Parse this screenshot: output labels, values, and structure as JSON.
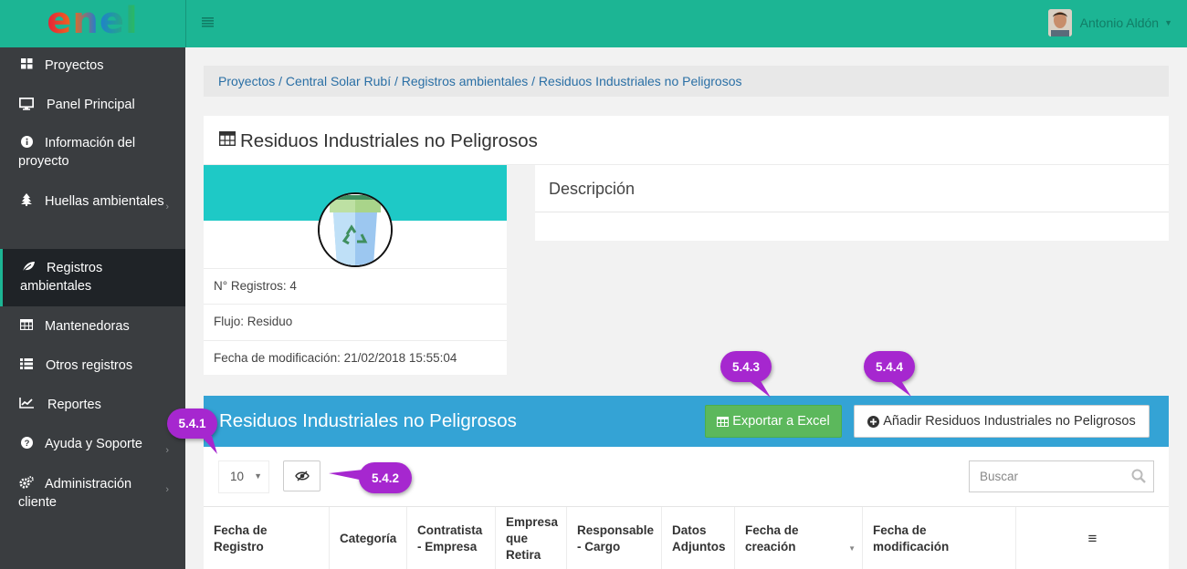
{
  "brand": {
    "logo_text": "enel",
    "logo_colors": [
      "#e41f3a",
      "#ee6a1e",
      "#1e7dd4",
      "#2bbf58"
    ]
  },
  "colors": {
    "accent": "#1cb594",
    "sidebar_bg": "#3a3d40",
    "sidebar_active_bg": "#1f2327",
    "bluebar": "#34a3d5",
    "excel_btn": "#5cb85c",
    "callout": "#a627cf"
  },
  "sidebar": {
    "items": [
      {
        "label": "Proyectos",
        "icon": "th-large-icon"
      },
      {
        "label": "Panel Principal",
        "icon": "monitor-icon"
      },
      {
        "label": "Información del proyecto",
        "icon": "info-circle-icon"
      },
      {
        "label": "Huellas ambientales",
        "icon": "tree-icon"
      },
      {
        "label": "Registros ambientales",
        "icon": "leaf-icon"
      },
      {
        "label": "Mantenedoras",
        "icon": "table-icon"
      },
      {
        "label": "Otros registros",
        "icon": "list-icon"
      },
      {
        "label": "Reportes",
        "icon": "line-chart-icon"
      },
      {
        "label": "Ayuda y Soporte",
        "icon": "question-circle-icon"
      },
      {
        "label": "Administración cliente",
        "icon": "cogs-icon"
      }
    ]
  },
  "topbar": {
    "user_name": "Antonio Aldón"
  },
  "breadcrumb": "Proyectos / Central Solar Rubí / Registros ambientales / Residuos Industriales no Peligrosos",
  "page_title": "Residuos Industriales no Peligrosos",
  "card": {
    "registros": "N° Registros: 4",
    "flujo": "Flujo: Residuo",
    "fecha_mod": "Fecha de modificación: 21/02/2018 15:55:04"
  },
  "description": {
    "title": "Descripción"
  },
  "table_panel": {
    "title": "Residuos Industriales no Peligrosos",
    "export_label": "Exportar a Excel",
    "add_label": "Añadir Residuos Industriales no Peligrosos",
    "page_length": "10",
    "search_placeholder": "Buscar",
    "columns": [
      "Fecha de Registro",
      "Categoría",
      "Contratista - Empresa",
      "Empresa que Retira",
      "Responsable - Cargo",
      "Datos Adjuntos",
      "Fecha de creación",
      "Fecha de modificación",
      "≡"
    ]
  },
  "callouts": [
    "5.4.1",
    "5.4.2",
    "5.4.3",
    "5.4.4"
  ]
}
